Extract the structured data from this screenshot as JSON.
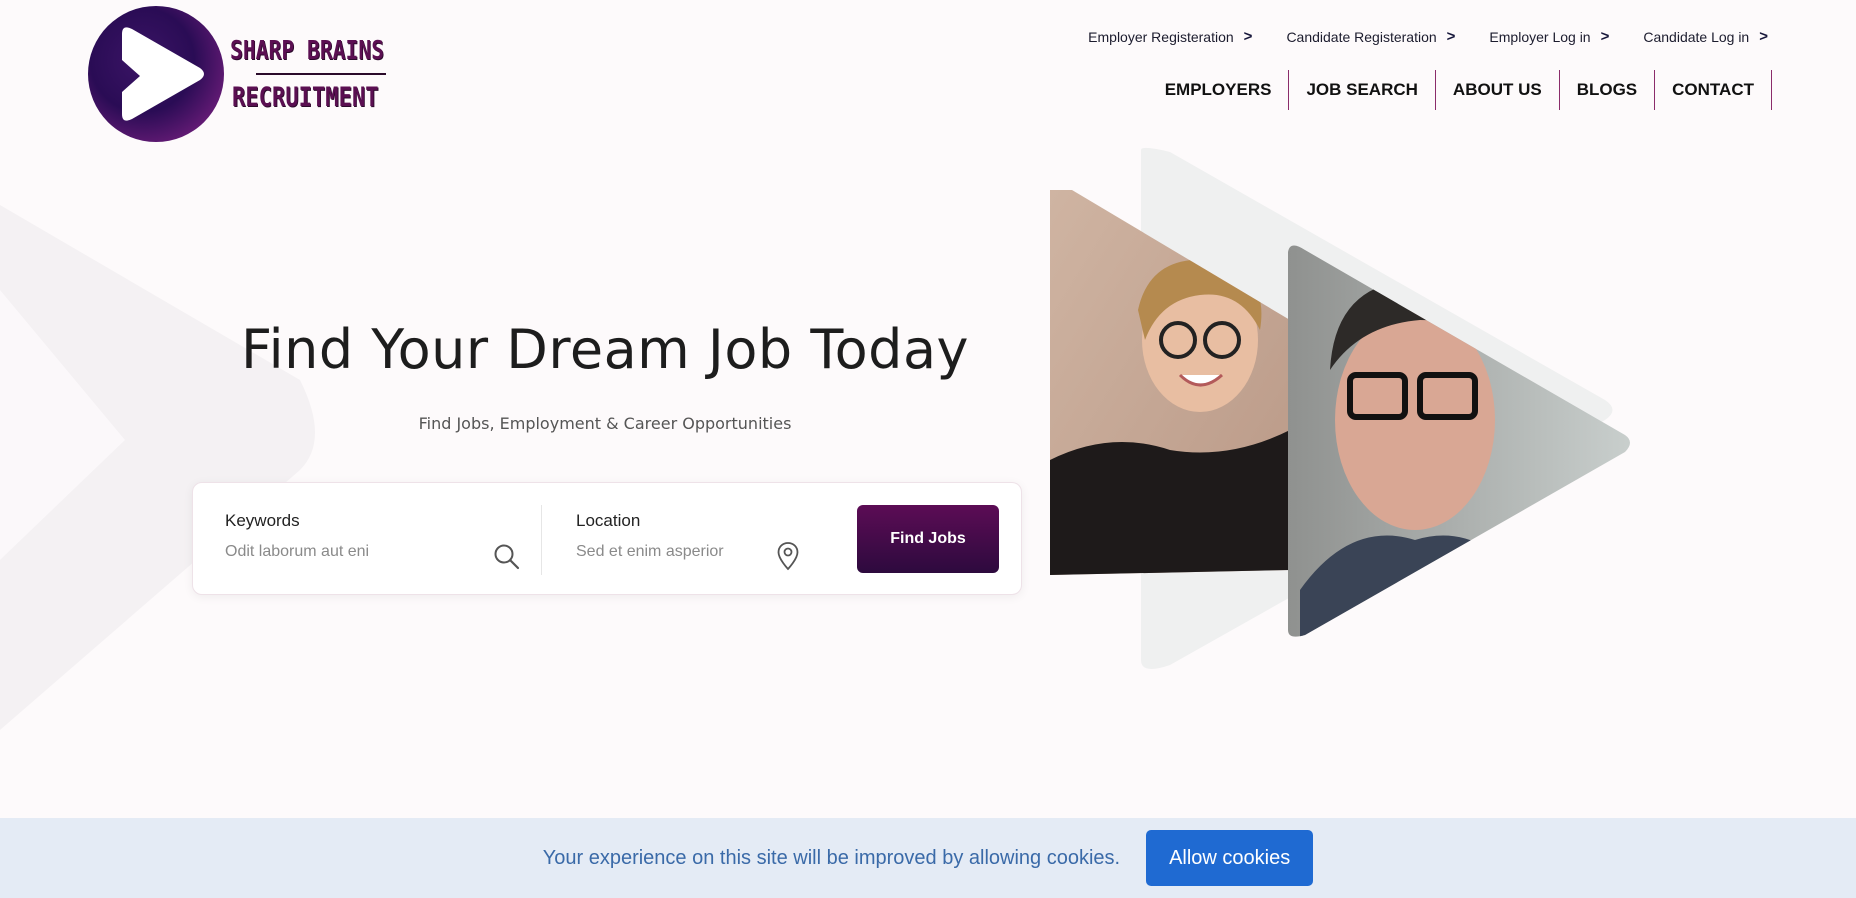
{
  "brand": {
    "line1": "SHARP BRAINS",
    "line2": "RECRUITMENT",
    "accent": "#5b0f52",
    "logo_icon": "play-icon"
  },
  "top_links": [
    {
      "label": "Employer Registeration",
      "icon": "chevron-right-icon"
    },
    {
      "label": "Candidate Registeration",
      "icon": "chevron-right-icon"
    },
    {
      "label": "Employer Log in",
      "icon": "chevron-right-icon"
    },
    {
      "label": "Candidate Log in",
      "icon": "chevron-right-icon"
    }
  ],
  "nav": [
    "EMPLOYERS",
    "JOB SEARCH",
    "ABOUT US",
    "BLOGS",
    "CONTACT"
  ],
  "hero": {
    "title": "Find Your Dream Job Today",
    "subtitle": "Find Jobs, Employment & Career Opportunities"
  },
  "search": {
    "keywords_label": "Keywords",
    "keywords_placeholder": "Odit laborum aut eni",
    "location_label": "Location",
    "location_placeholder": "Sed et enim asperior",
    "button_label": "Find Jobs",
    "button_color": "#4a0b4c"
  },
  "cookie": {
    "message": "Your experience on this site will be improved by allowing cookies.",
    "button_label": "Allow cookies",
    "button_color": "#1f6ad2"
  }
}
